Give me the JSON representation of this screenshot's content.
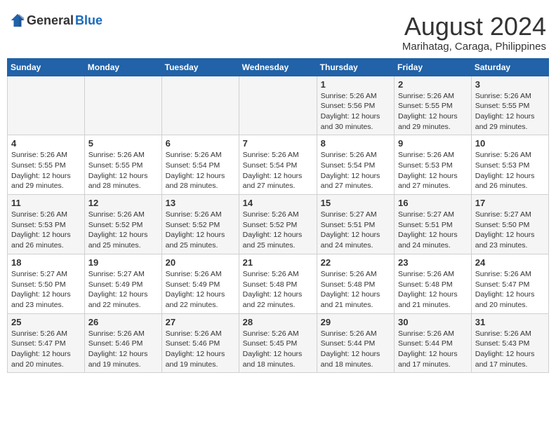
{
  "header": {
    "logo_general": "General",
    "logo_blue": "Blue",
    "month_year": "August 2024",
    "location": "Marihatag, Caraga, Philippines"
  },
  "weekdays": [
    "Sunday",
    "Monday",
    "Tuesday",
    "Wednesday",
    "Thursday",
    "Friday",
    "Saturday"
  ],
  "weeks": [
    [
      {
        "day": "",
        "sunrise": "",
        "sunset": "",
        "daylight": ""
      },
      {
        "day": "",
        "sunrise": "",
        "sunset": "",
        "daylight": ""
      },
      {
        "day": "",
        "sunrise": "",
        "sunset": "",
        "daylight": ""
      },
      {
        "day": "",
        "sunrise": "",
        "sunset": "",
        "daylight": ""
      },
      {
        "day": "1",
        "sunrise": "Sunrise: 5:26 AM",
        "sunset": "Sunset: 5:56 PM",
        "daylight": "Daylight: 12 hours and 30 minutes."
      },
      {
        "day": "2",
        "sunrise": "Sunrise: 5:26 AM",
        "sunset": "Sunset: 5:55 PM",
        "daylight": "Daylight: 12 hours and 29 minutes."
      },
      {
        "day": "3",
        "sunrise": "Sunrise: 5:26 AM",
        "sunset": "Sunset: 5:55 PM",
        "daylight": "Daylight: 12 hours and 29 minutes."
      }
    ],
    [
      {
        "day": "4",
        "sunrise": "Sunrise: 5:26 AM",
        "sunset": "Sunset: 5:55 PM",
        "daylight": "Daylight: 12 hours and 29 minutes."
      },
      {
        "day": "5",
        "sunrise": "Sunrise: 5:26 AM",
        "sunset": "Sunset: 5:55 PM",
        "daylight": "Daylight: 12 hours and 28 minutes."
      },
      {
        "day": "6",
        "sunrise": "Sunrise: 5:26 AM",
        "sunset": "Sunset: 5:54 PM",
        "daylight": "Daylight: 12 hours and 28 minutes."
      },
      {
        "day": "7",
        "sunrise": "Sunrise: 5:26 AM",
        "sunset": "Sunset: 5:54 PM",
        "daylight": "Daylight: 12 hours and 27 minutes."
      },
      {
        "day": "8",
        "sunrise": "Sunrise: 5:26 AM",
        "sunset": "Sunset: 5:54 PM",
        "daylight": "Daylight: 12 hours and 27 minutes."
      },
      {
        "day": "9",
        "sunrise": "Sunrise: 5:26 AM",
        "sunset": "Sunset: 5:53 PM",
        "daylight": "Daylight: 12 hours and 27 minutes."
      },
      {
        "day": "10",
        "sunrise": "Sunrise: 5:26 AM",
        "sunset": "Sunset: 5:53 PM",
        "daylight": "Daylight: 12 hours and 26 minutes."
      }
    ],
    [
      {
        "day": "11",
        "sunrise": "Sunrise: 5:26 AM",
        "sunset": "Sunset: 5:53 PM",
        "daylight": "Daylight: 12 hours and 26 minutes."
      },
      {
        "day": "12",
        "sunrise": "Sunrise: 5:26 AM",
        "sunset": "Sunset: 5:52 PM",
        "daylight": "Daylight: 12 hours and 25 minutes."
      },
      {
        "day": "13",
        "sunrise": "Sunrise: 5:26 AM",
        "sunset": "Sunset: 5:52 PM",
        "daylight": "Daylight: 12 hours and 25 minutes."
      },
      {
        "day": "14",
        "sunrise": "Sunrise: 5:26 AM",
        "sunset": "Sunset: 5:52 PM",
        "daylight": "Daylight: 12 hours and 25 minutes."
      },
      {
        "day": "15",
        "sunrise": "Sunrise: 5:27 AM",
        "sunset": "Sunset: 5:51 PM",
        "daylight": "Daylight: 12 hours and 24 minutes."
      },
      {
        "day": "16",
        "sunrise": "Sunrise: 5:27 AM",
        "sunset": "Sunset: 5:51 PM",
        "daylight": "Daylight: 12 hours and 24 minutes."
      },
      {
        "day": "17",
        "sunrise": "Sunrise: 5:27 AM",
        "sunset": "Sunset: 5:50 PM",
        "daylight": "Daylight: 12 hours and 23 minutes."
      }
    ],
    [
      {
        "day": "18",
        "sunrise": "Sunrise: 5:27 AM",
        "sunset": "Sunset: 5:50 PM",
        "daylight": "Daylight: 12 hours and 23 minutes."
      },
      {
        "day": "19",
        "sunrise": "Sunrise: 5:27 AM",
        "sunset": "Sunset: 5:49 PM",
        "daylight": "Daylight: 12 hours and 22 minutes."
      },
      {
        "day": "20",
        "sunrise": "Sunrise: 5:26 AM",
        "sunset": "Sunset: 5:49 PM",
        "daylight": "Daylight: 12 hours and 22 minutes."
      },
      {
        "day": "21",
        "sunrise": "Sunrise: 5:26 AM",
        "sunset": "Sunset: 5:48 PM",
        "daylight": "Daylight: 12 hours and 22 minutes."
      },
      {
        "day": "22",
        "sunrise": "Sunrise: 5:26 AM",
        "sunset": "Sunset: 5:48 PM",
        "daylight": "Daylight: 12 hours and 21 minutes."
      },
      {
        "day": "23",
        "sunrise": "Sunrise: 5:26 AM",
        "sunset": "Sunset: 5:48 PM",
        "daylight": "Daylight: 12 hours and 21 minutes."
      },
      {
        "day": "24",
        "sunrise": "Sunrise: 5:26 AM",
        "sunset": "Sunset: 5:47 PM",
        "daylight": "Daylight: 12 hours and 20 minutes."
      }
    ],
    [
      {
        "day": "25",
        "sunrise": "Sunrise: 5:26 AM",
        "sunset": "Sunset: 5:47 PM",
        "daylight": "Daylight: 12 hours and 20 minutes."
      },
      {
        "day": "26",
        "sunrise": "Sunrise: 5:26 AM",
        "sunset": "Sunset: 5:46 PM",
        "daylight": "Daylight: 12 hours and 19 minutes."
      },
      {
        "day": "27",
        "sunrise": "Sunrise: 5:26 AM",
        "sunset": "Sunset: 5:46 PM",
        "daylight": "Daylight: 12 hours and 19 minutes."
      },
      {
        "day": "28",
        "sunrise": "Sunrise: 5:26 AM",
        "sunset": "Sunset: 5:45 PM",
        "daylight": "Daylight: 12 hours and 18 minutes."
      },
      {
        "day": "29",
        "sunrise": "Sunrise: 5:26 AM",
        "sunset": "Sunset: 5:44 PM",
        "daylight": "Daylight: 12 hours and 18 minutes."
      },
      {
        "day": "30",
        "sunrise": "Sunrise: 5:26 AM",
        "sunset": "Sunset: 5:44 PM",
        "daylight": "Daylight: 12 hours and 17 minutes."
      },
      {
        "day": "31",
        "sunrise": "Sunrise: 5:26 AM",
        "sunset": "Sunset: 5:43 PM",
        "daylight": "Daylight: 12 hours and 17 minutes."
      }
    ]
  ]
}
